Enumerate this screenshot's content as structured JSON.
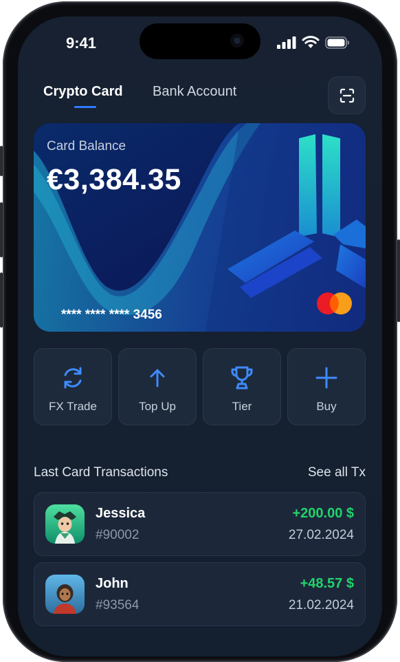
{
  "status": {
    "time": "9:41"
  },
  "tabs": {
    "active": "Crypto Card",
    "inactive": "Bank Account"
  },
  "card": {
    "label": "Card Balance",
    "balance": "€3,384.35",
    "number": "**** **** **** 3456",
    "network_icon": "mastercard-logo"
  },
  "actions": [
    {
      "label": "FX Trade",
      "icon": "refresh-icon"
    },
    {
      "label": "Top Up",
      "icon": "arrow-up-icon"
    },
    {
      "label": "Tier",
      "icon": "trophy-icon"
    },
    {
      "label": "Buy",
      "icon": "plus-icon"
    }
  ],
  "transactions_section": {
    "title": "Last Card Transactions",
    "see_all": "See all Tx"
  },
  "transactions": [
    {
      "name": "Jessica",
      "id": "#90002",
      "amount": "+200.00 $",
      "date": "27.02.2024"
    },
    {
      "name": "John",
      "id": "#93564",
      "amount": "+48.57 $",
      "date": "21.02.2024"
    }
  ],
  "colors": {
    "accent": "#2f7bff",
    "positive": "#22d36b",
    "screen_bg": "#172131",
    "surface": "#1d2a3b"
  }
}
